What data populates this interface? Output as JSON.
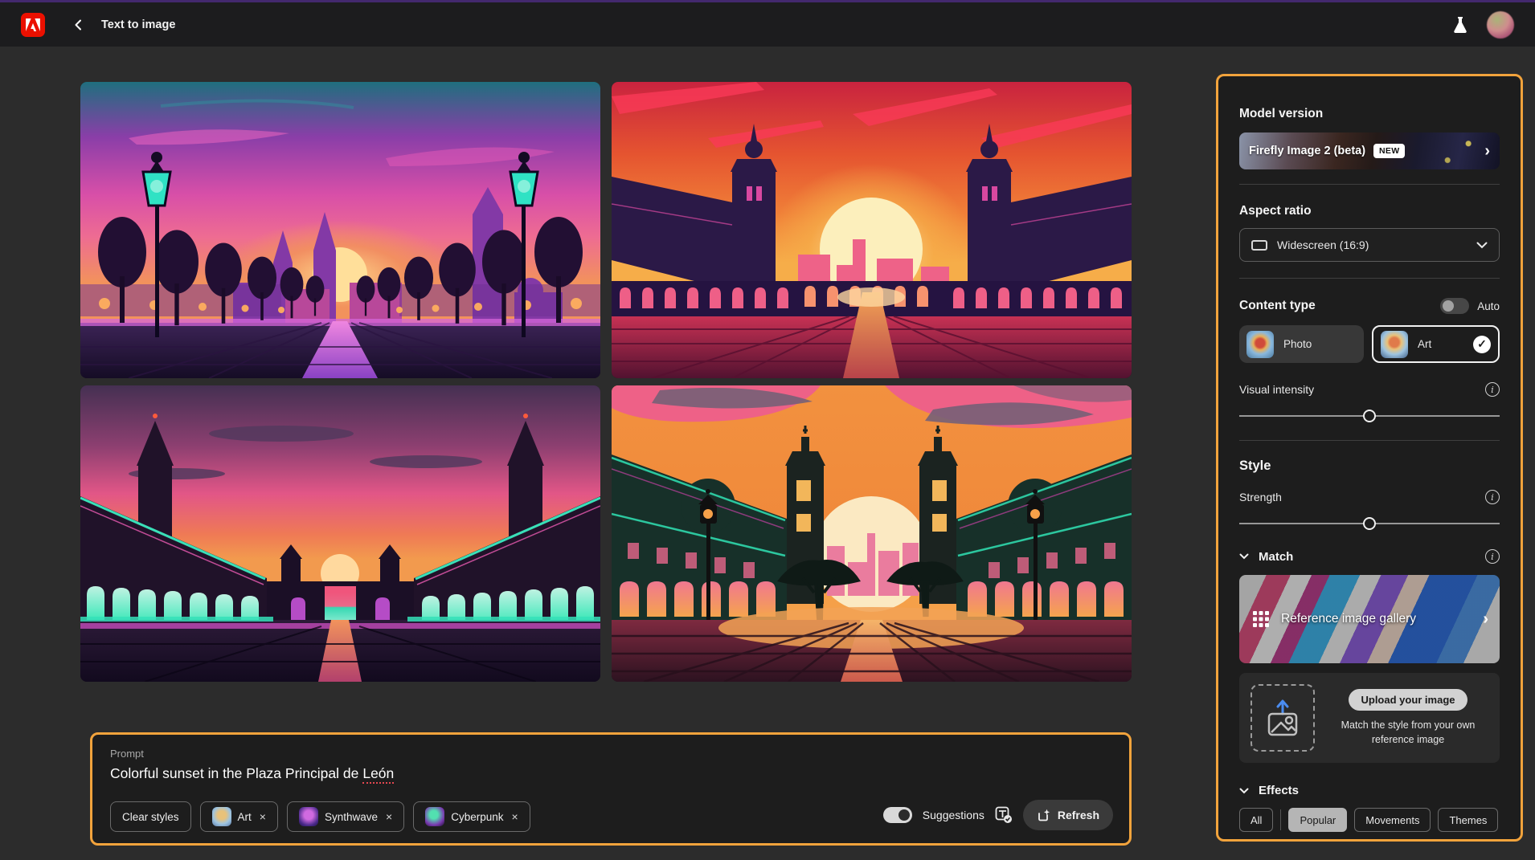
{
  "topbar": {
    "title": "Text to image"
  },
  "icons": {
    "close": "×",
    "check": "✓",
    "info": "i",
    "chevron_right": "›"
  },
  "images": [
    {
      "alt": "Synthwave purple plaza at sunset with teal street lanterns, statues, tree rows and glowing arcade"
    },
    {
      "alt": "Red-orange sunset plaza with large pale sun between two dark towers and colonnades"
    },
    {
      "alt": "Pink and orange sunset over gated plaza with teal glowing arcades and twin spires"
    },
    {
      "alt": "Orange sky plaza with large cream sun, pink skyline, teal buildings and tiled square"
    }
  ],
  "prompt_bar": {
    "label": "Prompt",
    "value": "Colorful sunset in the Plaza Principal de León",
    "value_main": "Colorful sunset in the Plaza Principal de",
    "misspelled_word": "León",
    "clear_styles_label": "Clear styles",
    "chips": [
      {
        "label": "Art"
      },
      {
        "label": "Synthwave"
      },
      {
        "label": "Cyberpunk"
      }
    ],
    "suggestions_label": "Suggestions",
    "suggestions_on": true,
    "refresh_label": "Refresh"
  },
  "sidebar": {
    "model_version": {
      "heading": "Model version",
      "value": "Firefly Image 2 (beta)",
      "badge": "NEW"
    },
    "aspect_ratio": {
      "heading": "Aspect ratio",
      "value": "Widescreen (16:9)"
    },
    "content_type": {
      "heading": "Content type",
      "auto_label": "Auto",
      "auto_on": false,
      "options": [
        {
          "label": "Photo",
          "selected": false
        },
        {
          "label": "Art",
          "selected": true
        }
      ]
    },
    "visual_intensity": {
      "label": "Visual intensity",
      "value_pct": 50
    },
    "style": {
      "heading": "Style",
      "strength_label": "Strength",
      "strength_pct": 50,
      "match_label": "Match",
      "gallery_label": "Reference image gallery",
      "upload_button": "Upload your image",
      "upload_caption": "Match the style from your own reference image"
    },
    "effects": {
      "heading": "Effects",
      "tabs": [
        {
          "label": "All",
          "selected": false
        },
        {
          "label": "Popular",
          "selected": true
        },
        {
          "label": "Movements",
          "selected": false
        },
        {
          "label": "Themes",
          "selected": false
        }
      ]
    }
  },
  "colors": {
    "accent_orange": "#F2A33C",
    "adobe_red": "#EB1000",
    "topbar_strip_purple": "#43286E",
    "panel_bg": "#1D1D1D",
    "page_bg": "#2C2C2C",
    "spellcheck_red": "#E34850"
  }
}
